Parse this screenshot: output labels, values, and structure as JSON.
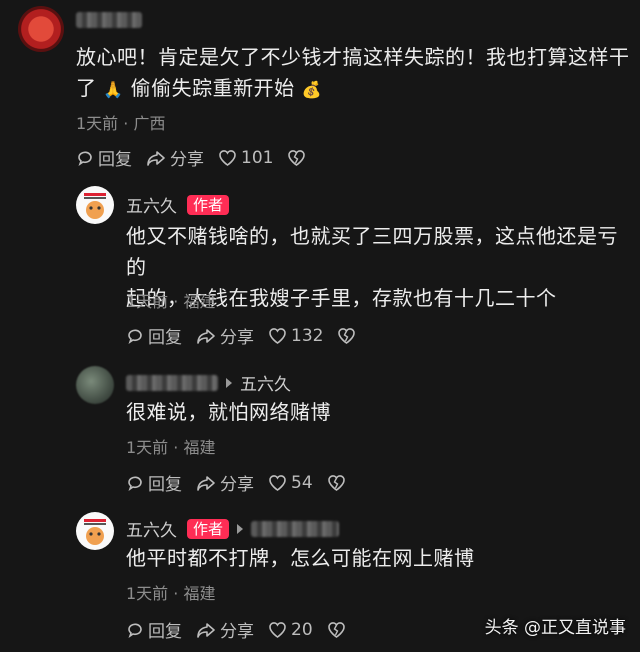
{
  "comments": [
    {
      "text_line1": "放心吧！肯定是欠了不少钱才搞这样失踪的！我也打算这样干",
      "text_line2": "了",
      "text_line2b": "偷偷失踪重新开始",
      "meta": "1天前 · 广西",
      "reply_label": "回复",
      "share_label": "分享",
      "likes": "101"
    },
    {
      "author": "五六久",
      "badge": "作者",
      "text_line1": "他又不赌钱啥的，也就买了三四万股票，这点他还是亏的",
      "text_line2": "起的，大钱在我嫂子手里，存款也有十几二十个",
      "meta": "1天前 · 福建",
      "reply_label": "回复",
      "share_label": "分享",
      "likes": "132"
    },
    {
      "reply_to": "五六久",
      "text_line1": "很难说，就怕网络赌博",
      "meta": "1天前 · 福建",
      "reply_label": "回复",
      "share_label": "分享",
      "likes": "54"
    },
    {
      "author": "五六久",
      "badge": "作者",
      "text_line1": "他平时都不打牌，怎么可能在网上赌博",
      "meta": "1天前 · 福建",
      "reply_label": "回复",
      "share_label": "分享",
      "likes": "20"
    }
  ],
  "watermark": "头条 @正又直说事",
  "icons": [
    "reply-icon",
    "share-icon",
    "heart-icon",
    "broken-heart-icon",
    "author-avatar-icon"
  ],
  "colors": {
    "background": "#161616",
    "badge": "#ff2d55",
    "meta": "#8d8d8d"
  }
}
